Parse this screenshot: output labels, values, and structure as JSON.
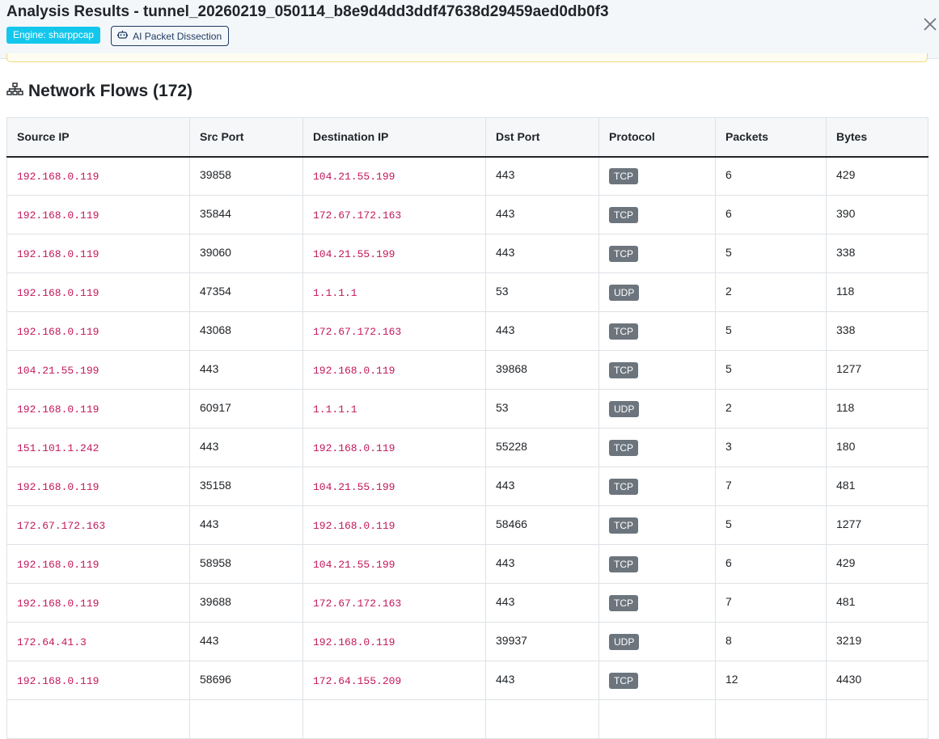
{
  "header": {
    "title": "Analysis Results - tunnel_20260219_050114_b8e9d4dd3ddf47638d29459aed0db0f3",
    "engine_badge": "Engine: sharppcap",
    "ai_button_label": "AI Packet Dissection",
    "ai_button_icon": "robot-icon",
    "close_icon": "close-icon"
  },
  "flows": {
    "title": "Network Flows (172)",
    "title_icon": "network-tree-icon",
    "columns": [
      "Source IP",
      "Src Port",
      "Destination IP",
      "Dst Port",
      "Protocol",
      "Packets",
      "Bytes"
    ],
    "rows": [
      [
        "192.168.0.119",
        "39858",
        "104.21.55.199",
        "443",
        "TCP",
        "6",
        "429"
      ],
      [
        "192.168.0.119",
        "35844",
        "172.67.172.163",
        "443",
        "TCP",
        "6",
        "390"
      ],
      [
        "192.168.0.119",
        "39060",
        "104.21.55.199",
        "443",
        "TCP",
        "5",
        "338"
      ],
      [
        "192.168.0.119",
        "47354",
        "1.1.1.1",
        "53",
        "UDP",
        "2",
        "118"
      ],
      [
        "192.168.0.119",
        "43068",
        "172.67.172.163",
        "443",
        "TCP",
        "5",
        "338"
      ],
      [
        "104.21.55.199",
        "443",
        "192.168.0.119",
        "39868",
        "TCP",
        "5",
        "1277"
      ],
      [
        "192.168.0.119",
        "60917",
        "1.1.1.1",
        "53",
        "UDP",
        "2",
        "118"
      ],
      [
        "151.101.1.242",
        "443",
        "192.168.0.119",
        "55228",
        "TCP",
        "3",
        "180"
      ],
      [
        "192.168.0.119",
        "35158",
        "104.21.55.199",
        "443",
        "TCP",
        "7",
        "481"
      ],
      [
        "172.67.172.163",
        "443",
        "192.168.0.119",
        "58466",
        "TCP",
        "5",
        "1277"
      ],
      [
        "192.168.0.119",
        "58958",
        "104.21.55.199",
        "443",
        "TCP",
        "6",
        "429"
      ],
      [
        "192.168.0.119",
        "39688",
        "172.67.172.163",
        "443",
        "TCP",
        "7",
        "481"
      ],
      [
        "172.64.41.3",
        "443",
        "192.168.0.119",
        "39937",
        "UDP",
        "8",
        "3219"
      ],
      [
        "192.168.0.119",
        "58696",
        "172.64.155.209",
        "443",
        "TCP",
        "12",
        "4430"
      ],
      [
        "",
        "",
        "",
        "",
        "",
        "",
        ""
      ]
    ]
  },
  "colors": {
    "engine_badge": "#13c7ec",
    "ip_text": "#c2185b",
    "protocol_badge": "#6c757d",
    "header_bg": "#f4f7fa"
  }
}
